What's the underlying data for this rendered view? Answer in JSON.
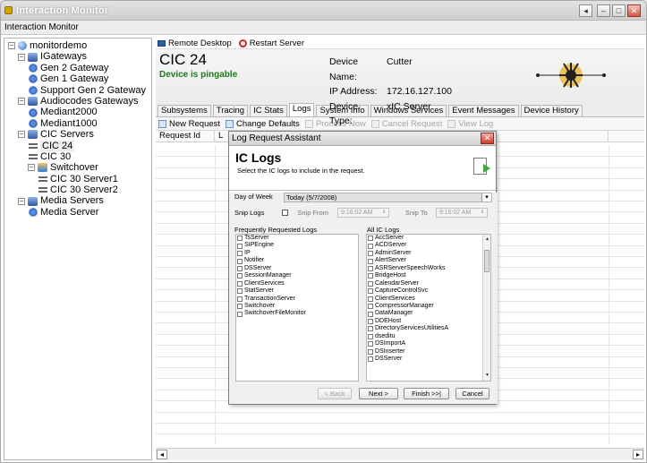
{
  "window": {
    "title": "Interaction Monitor",
    "menu_label": "Interaction Monitor"
  },
  "tree": {
    "items": [
      {
        "label": "monitordemo",
        "icon": "globe-icon",
        "expander": "−"
      },
      {
        "label": "IGateways",
        "icon": "server-group-icon",
        "expander": "−"
      },
      {
        "label": "Gen 2 Gateway",
        "icon": "gateway-icon"
      },
      {
        "label": "Gen 1 Gateway",
        "icon": "gateway-icon"
      },
      {
        "label": "Support Gen 2 Gateway",
        "icon": "gateway-icon"
      },
      {
        "label": "Audiocodes Gateways",
        "icon": "server-group-icon",
        "expander": "−"
      },
      {
        "label": "Mediant2000",
        "icon": "gateway-icon"
      },
      {
        "label": "Mediant1000",
        "icon": "gateway-icon"
      },
      {
        "label": "CIC Servers",
        "icon": "server-group-icon",
        "expander": "−"
      },
      {
        "label": "CIC 24",
        "icon": "plug-icon",
        "selected": true
      },
      {
        "label": "CIC 30",
        "icon": "plug-icon"
      },
      {
        "label": "Switchover",
        "icon": "switchover-icon",
        "expander": "−"
      },
      {
        "label": "CIC 30 Server1",
        "icon": "plug-icon"
      },
      {
        "label": "CIC 30 Server2",
        "icon": "plug-icon"
      },
      {
        "label": "Media Servers",
        "icon": "server-group-icon",
        "expander": "−"
      },
      {
        "label": "Media Server",
        "icon": "gateway-icon"
      }
    ]
  },
  "toolbar": {
    "remote_desktop": "Remote Desktop",
    "restart_server": "Restart Server"
  },
  "device": {
    "title": "CIC 24",
    "status": "Device is pingable",
    "name_label": "Device Name:",
    "name_value": "Cutter",
    "ip_label": "IP Address:",
    "ip_value": "172.16.127.100",
    "type_label": "Device Type:",
    "type_value": "xIC Server"
  },
  "tabs": [
    "Subsystems",
    "Tracing",
    "IC Stats",
    "Logs",
    "System Info",
    "Windows Services",
    "Event Messages",
    "Device History"
  ],
  "active_tab": "Logs",
  "logs_toolbar": {
    "new_request": "New Request",
    "change_defaults": "Change Defaults",
    "process_now": "Process Now",
    "cancel_request": "Cancel Request",
    "view_log": "View Log"
  },
  "grid_columns": [
    "Request Id",
    "L"
  ],
  "dialog": {
    "title": "Log Request Assistant",
    "heading": "IC Logs",
    "subheading": "Select the IC logs to include in the request.",
    "day_of_week_label": "Day of Week",
    "day_of_week_value": "Today (5/7/2008)",
    "snip_logs_label": "Snip Logs",
    "snip_from_label": "Snip From",
    "snip_from_value": "9:16:02 AM",
    "snip_to_label": "Snip To",
    "snip_to_value": "9:16:02 AM",
    "frequent_label": "Frequently Requested Logs",
    "all_label": "All IC Logs",
    "frequent_logs": [
      "TsServer",
      "SIPEngine",
      "IP",
      "Notifier",
      "DSServer",
      "SessionManager",
      "ClientServices",
      "StatServer",
      "TransactionServer",
      "Switchover",
      "SwitchoverFileMonitor"
    ],
    "all_logs": [
      "AccServer",
      "ACDServer",
      "AdminServer",
      "AlertServer",
      "ASRServerSpeechWorks",
      "BridgeHost",
      "CalendarServer",
      "CaptureControlSvc",
      "ClientServices",
      "CompressorManager",
      "DataManager",
      "DDEHost",
      "DirectoryServicesUtilitiesA",
      "dseditu",
      "DSImportA",
      "DSInserter",
      "DSServer"
    ],
    "back": "< Back",
    "next": "Next >",
    "finish": "Finish >>|",
    "cancel": "Cancel"
  }
}
